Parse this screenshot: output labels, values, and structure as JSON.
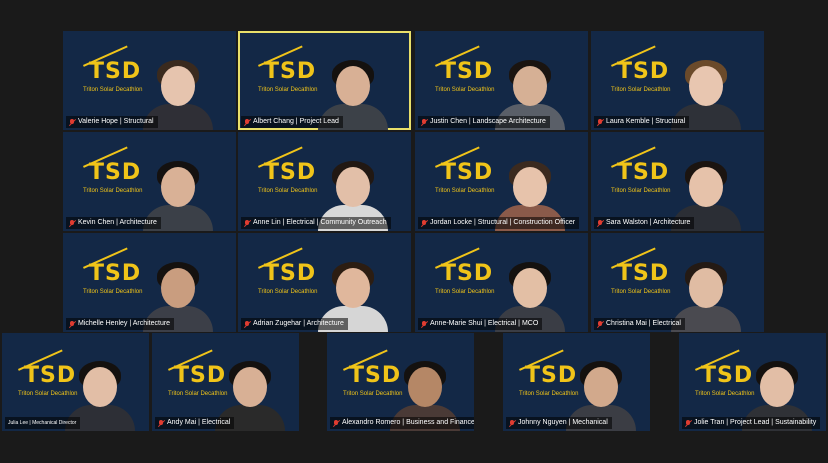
{
  "logo": {
    "letters": "TSD",
    "tagline": "Triton Solar Decathlon"
  },
  "participants": [
    {
      "name": "Valerie Hope | Structural",
      "muted": true
    },
    {
      "name": "Albert Chang | Project Lead",
      "muted": true,
      "speaking": true
    },
    {
      "name": "Justin Chen | Landscape Architecture",
      "muted": true
    },
    {
      "name": "Laura Kemble | Structural",
      "muted": true
    },
    {
      "name": "Kevin Chen | Architecture",
      "muted": true
    },
    {
      "name": "Anne Lin | Electrical | Community Outreach",
      "muted": true
    },
    {
      "name": "Jordan Locke | Structural | Construction Officer",
      "muted": true
    },
    {
      "name": "Sara Walston | Architecture",
      "muted": true
    },
    {
      "name": "Michelle Henley | Architecture",
      "muted": true
    },
    {
      "name": "Adrian Zugehar | Architecture",
      "muted": true
    },
    {
      "name": "Anne-Marie Shui | Electrical | MCO",
      "muted": true
    },
    {
      "name": "Christina Mai | Electrical",
      "muted": true
    },
    {
      "name": "Julia Lee | Mechanical Director",
      "muted": false
    },
    {
      "name": "Andy Mai | Electrical",
      "muted": true
    },
    {
      "name": "Alexandro Romero | Business and Finance Analysis",
      "muted": true
    },
    {
      "name": "Johnny Nguyen | Mechanical",
      "muted": true
    },
    {
      "name": "Jolie Tran | Project Lead | Sustainability",
      "muted": true
    }
  ],
  "colors": {
    "tile_bg": "#132846",
    "logo": "#f0c419",
    "speaker_border": "#e9e06a",
    "muted_icon": "#e03c31"
  }
}
